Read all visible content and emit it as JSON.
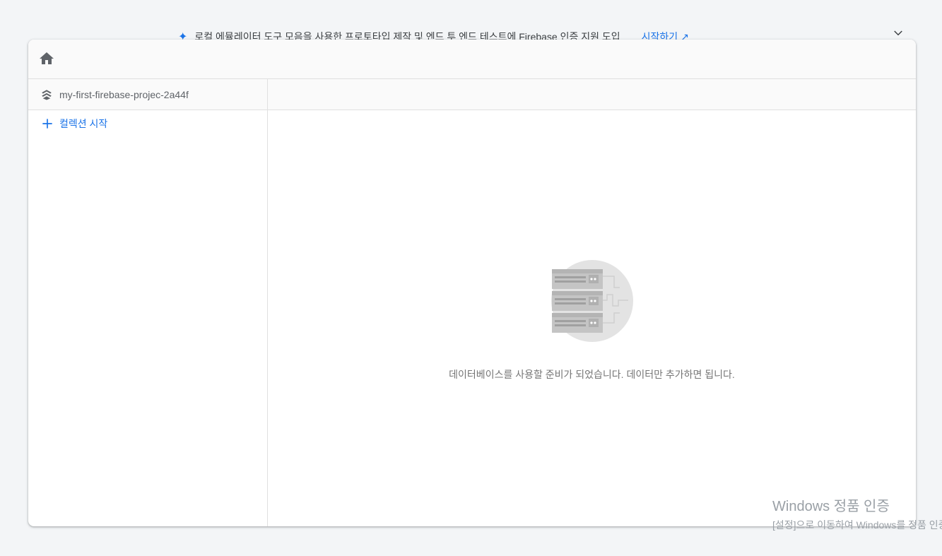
{
  "banner": {
    "icon": "sparkle-icon",
    "text": "로컬 에뮬레이터 도구 모음을 사용한 프로토타입 제작 및 엔드 투 엔드 테스트에 Firebase 인증 지원 도입",
    "link_label": "시작하기",
    "link_icon": "external-link-icon",
    "collapse_icon": "chevron-down-icon"
  },
  "header": {
    "home_icon": "home-icon"
  },
  "panel_left": {
    "database_icon": "firestore-icon",
    "database_name": "my-first-firebase-projec-2a44f",
    "add_collection_label": "컬렉션 시작"
  },
  "panel_right": {
    "empty_illustration": "server-rack-illustration",
    "empty_message": "데이터베이스를 사용할 준비가 되었습니다. 데이터만 추가하면 됩니다."
  },
  "watermark": {
    "title": "Windows 정품 인증",
    "subtitle": "[설정]으로 이동하여 Windows를 정품 인증합니다."
  },
  "colors": {
    "accent": "#1a73e8",
    "text_muted": "#5f6368",
    "border": "#e0e0e0",
    "background": "#f3f5f7"
  }
}
